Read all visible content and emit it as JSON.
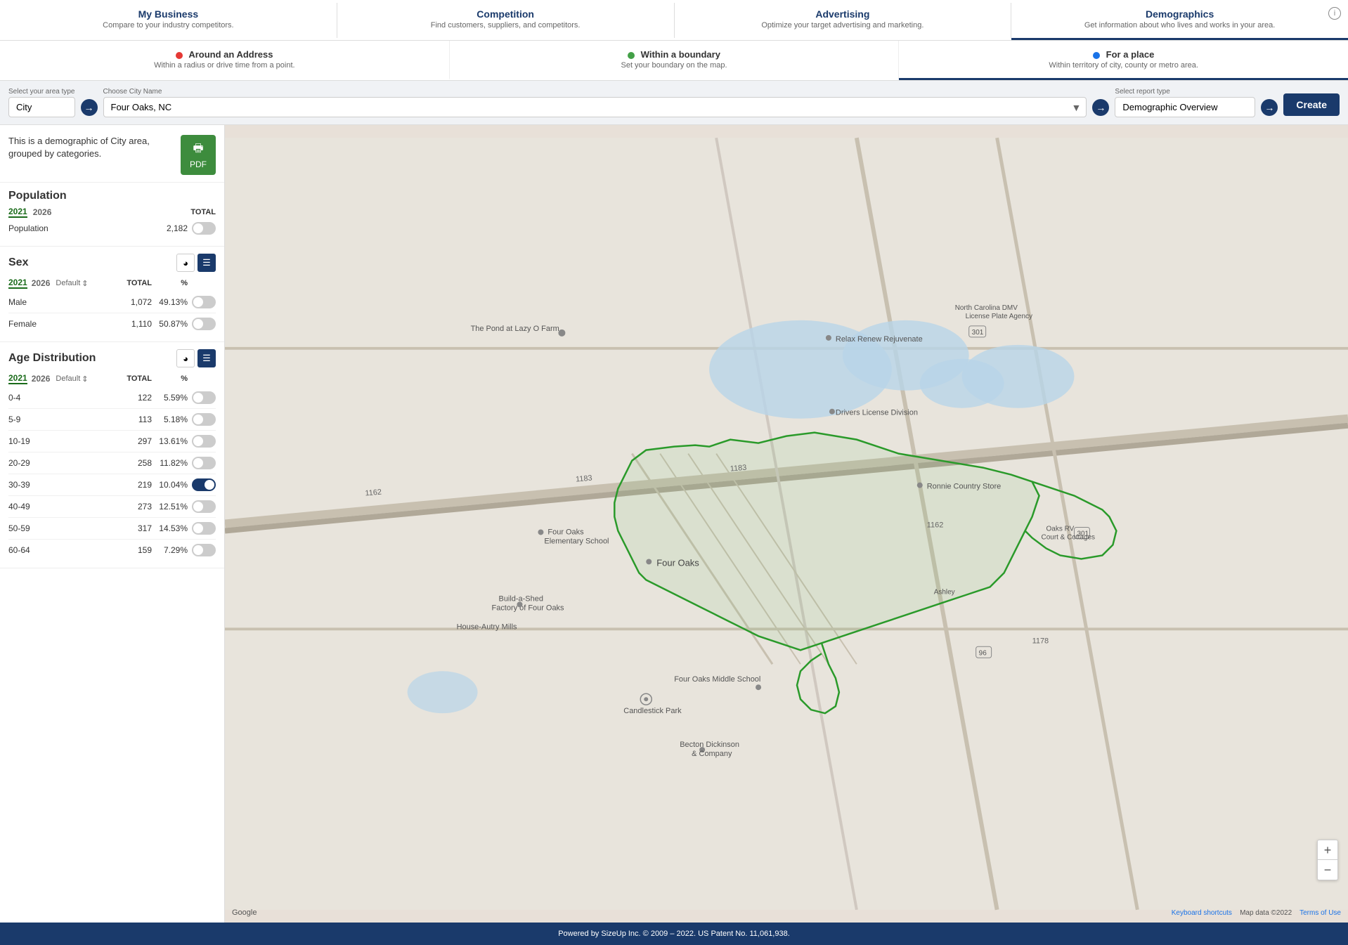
{
  "topnav": {
    "items": [
      {
        "id": "my-business",
        "title": "My Business",
        "sub": "Compare to your industry competitors.",
        "active": false
      },
      {
        "id": "competition",
        "title": "Competition",
        "sub": "Find customers, suppliers, and competitors.",
        "active": false
      },
      {
        "id": "advertising",
        "title": "Advertising",
        "sub": "Optimize your target advertising and marketing.",
        "active": false
      },
      {
        "id": "demographics",
        "title": "Demographics",
        "sub": "Get information about who lives and works in your area.",
        "active": true
      }
    ]
  },
  "location_tabs": [
    {
      "id": "around-address",
      "dot": "red",
      "title": "Around an Address",
      "sub": "Within a radius or drive time from a point.",
      "active": false
    },
    {
      "id": "within-boundary",
      "dot": "green",
      "title": "Within a boundary",
      "sub": "Set your boundary on the map.",
      "active": false
    },
    {
      "id": "for-a-place",
      "dot": "blue",
      "title": "For a place",
      "sub": "Within territory of city, county or metro area.",
      "active": true
    }
  ],
  "controls": {
    "area_type_label": "Select your area type",
    "area_type_value": "City",
    "city_label": "Choose City Name",
    "city_value": "Four Oaks, NC",
    "report_type_label": "Select report type",
    "report_type_value": "Demographic Overview",
    "create_label": "Create"
  },
  "panel": {
    "description": "This is a demographic of City area, grouped by categories.",
    "pdf_label": "PDF",
    "population": {
      "title": "Population",
      "year_2021": "2021",
      "year_2026": "2026",
      "total_label": "TOTAL",
      "rows": [
        {
          "label": "Population",
          "value": "2,182",
          "toggle": false
        }
      ]
    },
    "sex": {
      "title": "Sex",
      "year_2021": "2021",
      "year_2026": "2026",
      "default_label": "Default",
      "total_label": "TOTAL",
      "pct_label": "%",
      "rows": [
        {
          "label": "Male",
          "value": "1,072",
          "pct": "49.13%",
          "toggle": false
        },
        {
          "label": "Female",
          "value": "1,110",
          "pct": "50.87%",
          "toggle": false
        }
      ]
    },
    "age": {
      "title": "Age Distribution",
      "year_2021": "2021",
      "year_2026": "2026",
      "default_label": "Default",
      "total_label": "TOTAL",
      "pct_label": "%",
      "rows": [
        {
          "label": "0-4",
          "value": "122",
          "pct": "5.59%",
          "toggle": false
        },
        {
          "label": "5-9",
          "value": "113",
          "pct": "5.18%",
          "toggle": false
        },
        {
          "label": "10-19",
          "value": "297",
          "pct": "13.61%",
          "toggle": false
        },
        {
          "label": "20-29",
          "value": "258",
          "pct": "11.82%",
          "toggle": false
        },
        {
          "label": "30-39",
          "value": "219",
          "pct": "10.04%",
          "toggle": true
        },
        {
          "label": "40-49",
          "value": "273",
          "pct": "12.51%",
          "toggle": false
        },
        {
          "label": "50-59",
          "value": "317",
          "pct": "14.53%",
          "toggle": false
        },
        {
          "label": "60-64",
          "value": "159",
          "pct": "7.29%",
          "toggle": false
        }
      ]
    }
  },
  "map": {
    "attribution": "Google",
    "map_data": "Map data ©2022",
    "keyboard_shortcuts": "Keyboard shortcuts",
    "terms": "Terms of Use",
    "zoom_in": "+",
    "zoom_out": "−"
  },
  "footer": {
    "text": "Powered by SizeUp Inc. © 2009 – 2022. US Patent No. 11,061,938."
  }
}
